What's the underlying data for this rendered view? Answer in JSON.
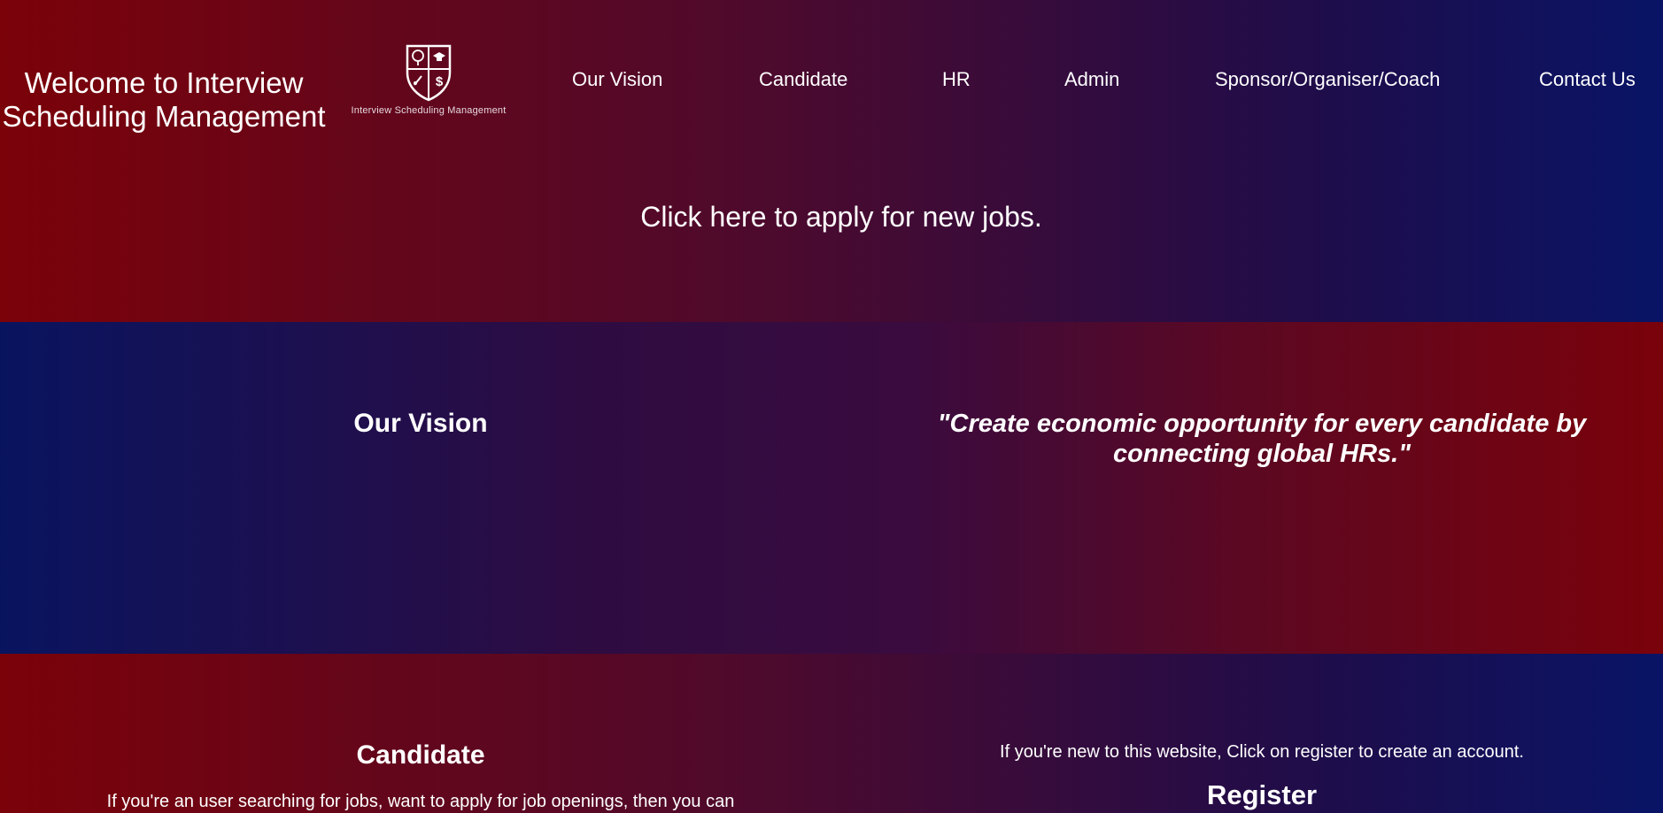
{
  "header": {
    "title": "Welcome to Interview Scheduling Management",
    "logo_caption": "Interview Scheduling Management",
    "nav": [
      {
        "label": "Our Vision"
      },
      {
        "label": "Candidate"
      },
      {
        "label": "HR"
      },
      {
        "label": "Admin"
      },
      {
        "label": "Sponsor/Organiser/Coach"
      },
      {
        "label": "Contact Us"
      }
    ],
    "apply_link": "Click here to apply for new jobs."
  },
  "vision": {
    "heading": "Our Vision",
    "quote": "\"Create economic opportunity for every candidate by connecting global HRs.\""
  },
  "candidate": {
    "heading": "Candidate",
    "description": "If you're an user searching for jobs, want to apply for job openings, then you can",
    "register_prompt": "If you're new to this website, Click on register to create an account.",
    "register_label": "Register"
  },
  "colors": {
    "red": "#7b0209",
    "navy": "#091466",
    "text": "#ffffff"
  },
  "icons": {
    "logo": "shield-crest-icon"
  }
}
